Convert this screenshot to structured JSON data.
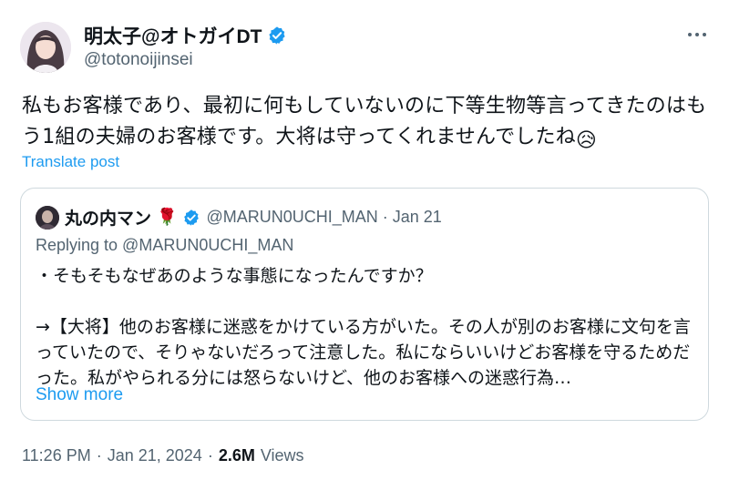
{
  "author": {
    "display_name": "明太子@オトガイDT",
    "handle": "@totonoijinsei",
    "avatar_icon": "profile-photo",
    "verified_icon": "verified-badge-icon"
  },
  "post": {
    "text": "私もお客様であり、最初に何もしていないのに下等生物等言ってきたのはもう1組の夫婦のお客様です。大将は守ってくれませんでしたね",
    "emoji": "😥",
    "translate_label": "Translate post"
  },
  "quote": {
    "display_name": "丸の内マン",
    "name_emoji": "🌹",
    "handle_date": "@MARUN0UCHI_MAN · Jan 21",
    "replying_to": "Replying to @MARUN0UCHI_MAN",
    "text": "・そもそもなぜあのような事態になったんですか？\n\n→【大将】他のお客様に迷惑をかけている方がいた。その人が別のお客様に文句を言っていたので、そりゃないだろって注意した。私にならいいけどお客様を守るためだった。私がやられる分には怒らないけど、他のお客様への迷惑行為…",
    "show_more_label": "Show more"
  },
  "meta": {
    "time": "11:26 PM",
    "sep1": "·",
    "date": "Jan 21, 2024",
    "sep2": "·",
    "views_count": "2.6M",
    "views_label": "Views"
  },
  "colors": {
    "accent": "#1d9bf0",
    "secondary_text": "#536471",
    "border": "#cfd9de"
  }
}
